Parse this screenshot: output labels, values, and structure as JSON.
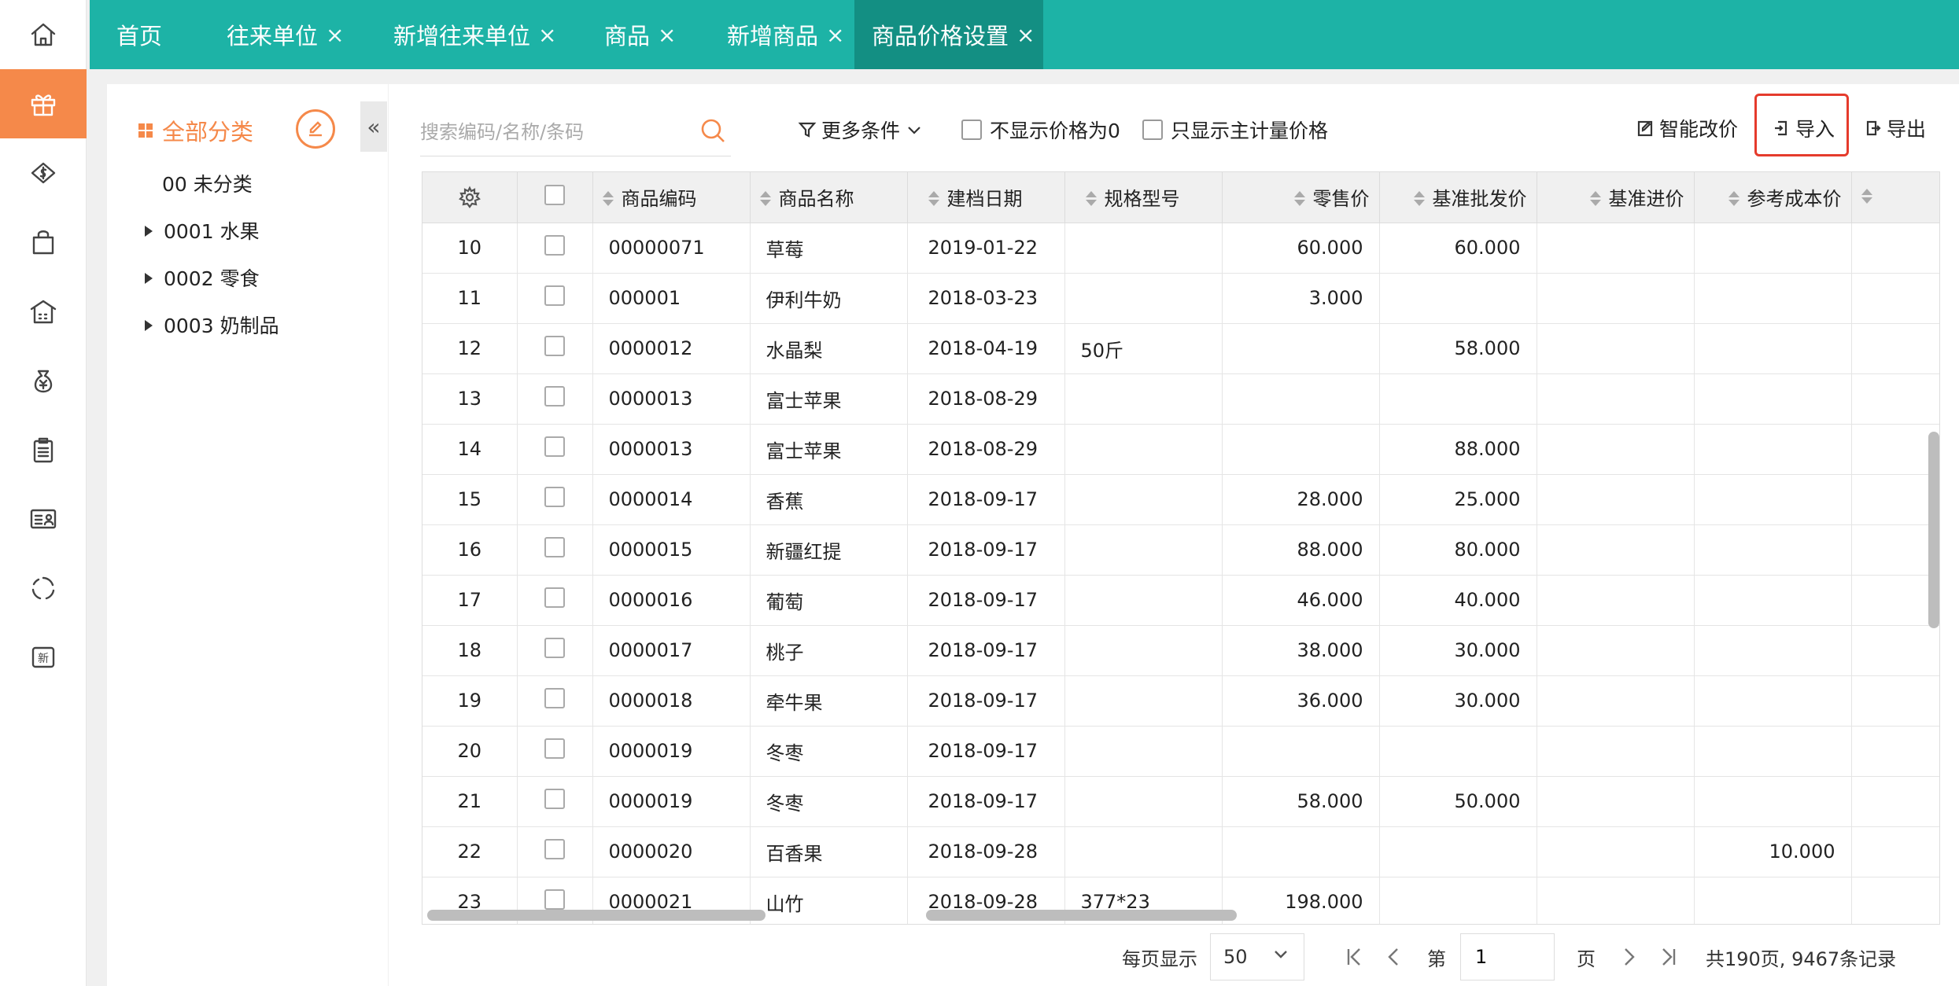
{
  "rail": {
    "items": [
      {
        "icon": "home-icon"
      },
      {
        "icon": "gift-icon"
      },
      {
        "icon": "money-tag-icon"
      },
      {
        "icon": "shopping-bag-icon"
      },
      {
        "icon": "warehouse-icon"
      },
      {
        "icon": "money-bag-icon"
      },
      {
        "icon": "clipboard-icon"
      },
      {
        "icon": "id-card-icon"
      },
      {
        "icon": "refresh-circle-icon"
      },
      {
        "icon": "new-badge-icon",
        "text": "新"
      }
    ],
    "active_index": 1,
    "accent": "#f5894a"
  },
  "tabs": [
    {
      "label": "首页",
      "closable": false
    },
    {
      "label": "往来单位",
      "closable": true
    },
    {
      "label": "新增往来单位",
      "closable": true
    },
    {
      "label": "商品",
      "closable": true
    },
    {
      "label": "新增商品",
      "closable": true
    },
    {
      "label": "商品价格设置",
      "closable": true,
      "active": true
    }
  ],
  "tab_close_glyph": "×",
  "tabbar_color": "#1db3a6",
  "category": {
    "title": "全部分类",
    "items": [
      {
        "label": "00 未分类",
        "expandable": false
      },
      {
        "label": "0001 水果",
        "expandable": true
      },
      {
        "label": "0002 零食",
        "expandable": true
      },
      {
        "label": "0003 奶制品",
        "expandable": true
      }
    ],
    "collapse_glyph": "«"
  },
  "toolbar": {
    "search_placeholder": "搜索编码/名称/条码",
    "more_conditions": "更多条件",
    "hide_zero_price": "不显示价格为0",
    "main_unit_only": "只显示主计量价格",
    "smart_edit": "智能改价",
    "import": "导入",
    "export": "导出"
  },
  "table": {
    "columns": [
      "",
      "",
      "商品编码",
      "商品名称",
      "建档日期",
      "规格型号",
      "零售价",
      "基准批发价",
      "基准进价",
      "参考成本价"
    ],
    "rows": [
      [
        "10",
        "00000071",
        "草莓",
        "2019-01-22",
        "",
        "60.000",
        "60.000",
        "",
        ""
      ],
      [
        "11",
        "000001",
        "伊利牛奶",
        "2018-03-23",
        "",
        "3.000",
        "",
        "",
        ""
      ],
      [
        "12",
        "0000012",
        "水晶梨",
        "2018-04-19",
        "50斤",
        "",
        "58.000",
        "",
        ""
      ],
      [
        "13",
        "0000013",
        "富士苹果",
        "2018-08-29",
        "",
        "",
        "",
        "",
        ""
      ],
      [
        "14",
        "0000013",
        "富士苹果",
        "2018-08-29",
        "",
        "",
        "88.000",
        "",
        ""
      ],
      [
        "15",
        "0000014",
        "香蕉",
        "2018-09-17",
        "",
        "28.000",
        "25.000",
        "",
        ""
      ],
      [
        "16",
        "0000015",
        "新疆红提",
        "2018-09-17",
        "",
        "88.000",
        "80.000",
        "",
        ""
      ],
      [
        "17",
        "0000016",
        "葡萄",
        "2018-09-17",
        "",
        "46.000",
        "40.000",
        "",
        ""
      ],
      [
        "18",
        "0000017",
        "桃子",
        "2018-09-17",
        "",
        "38.000",
        "30.000",
        "",
        ""
      ],
      [
        "19",
        "0000018",
        "牵牛果",
        "2018-09-17",
        "",
        "36.000",
        "30.000",
        "",
        ""
      ],
      [
        "20",
        "0000019",
        "冬枣",
        "2018-09-17",
        "",
        "",
        "",
        "",
        ""
      ],
      [
        "21",
        "0000019",
        "冬枣",
        "2018-09-17",
        "",
        "58.000",
        "50.000",
        "",
        ""
      ],
      [
        "22",
        "0000020",
        "百香果",
        "2018-09-28",
        "",
        "",
        "",
        "",
        "10.000"
      ],
      [
        "23",
        "0000021",
        "山竹",
        "2018-09-28",
        "377*23",
        "198.000",
        "",
        "",
        ""
      ]
    ]
  },
  "pagination": {
    "per_page_label": "每页显示",
    "per_page_value": "50",
    "page_prefix": "第",
    "page_value": "1",
    "page_suffix": "页",
    "summary": "共190页, 9467条记录"
  }
}
